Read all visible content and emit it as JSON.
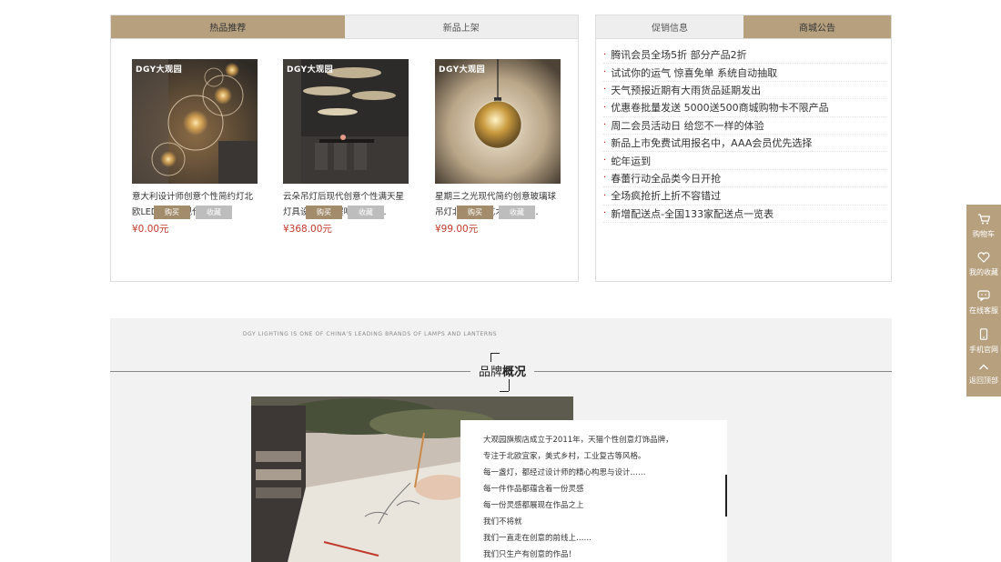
{
  "product_tabs": [
    "热品推荐",
    "新品上架"
  ],
  "products": [
    {
      "logo": "DGY大观园",
      "title_line1": "意大利设计师创意个性简约灯北",
      "title_line2": "欧LED客厅后现代分子...",
      "price": "¥0.00元",
      "buy_label": "购买",
      "fav_label": "收藏"
    },
    {
      "logo": "DGY大观园",
      "title_line1": "云朵吊灯后现代创意个性满天星",
      "title_line2": "灯具设计师工程吧台餐厅...",
      "price": "¥368.00元",
      "buy_label": "购买",
      "fav_label": "收藏"
    },
    {
      "logo": "DGY大观园",
      "title_line1": "星期三之光现代简约创意玻璃球",
      "title_line2": "吊灯北欧个性艺术餐厅书...",
      "price": "¥99.00元",
      "buy_label": "购买",
      "fav_label": "收藏"
    }
  ],
  "notice_tabs": [
    "促销信息",
    "商城公告"
  ],
  "notices": [
    "腾讯会员全场5折 部分产品2折",
    "试试你的运气 惊喜免单 系统自动抽取",
    "天气预报近期有大雨货品延期发出",
    "优惠卷批量发送 5000送500商城购物卡不限产品",
    "周二会员活动日 给您不一样的体验",
    "新品上市免费试用报名中，AAA会员优先选择",
    "蛇年运到",
    "春蕾行动全品类今日开抢",
    "全场疯抢折上折不容错过",
    "新增配送点-全国133家配送点一览表"
  ],
  "sidebar": [
    {
      "label": "购物车",
      "icon": "cart-icon"
    },
    {
      "label": "我的收藏",
      "icon": "heart-icon"
    },
    {
      "label": "在线客服",
      "icon": "chat-icon"
    },
    {
      "label": "手机官网",
      "icon": "phone-icon"
    },
    {
      "label": "返回顶部",
      "icon": "arrow-up-icon"
    }
  ],
  "brand": {
    "tagline": "DGY LIGHTING IS ONE OF CHINA'S LEADING BRANDS OF LAMPS AND LANTERNS",
    "title_normal": "品牌",
    "title_bold": "概况",
    "lines": [
      "大观园旗舰店成立于2011年，天猫个性创意灯饰品牌，",
      "专注于北欧宜家，美式乡村，工业复古等风格。",
      "每一盏灯，都经过设计师的精心构思与设计……",
      "每一件作品都蕴含着一份灵感",
      "每一份灵感都展现在作品之上",
      "我们不将就",
      "我们一直走在创意的前线上……",
      "我们只生产有创意的作品！"
    ]
  },
  "colors": {
    "accent": "#b6a07e",
    "price": "#c0392b",
    "buy_button": "#a28c6b",
    "fav_button": "#bdbdbd"
  }
}
